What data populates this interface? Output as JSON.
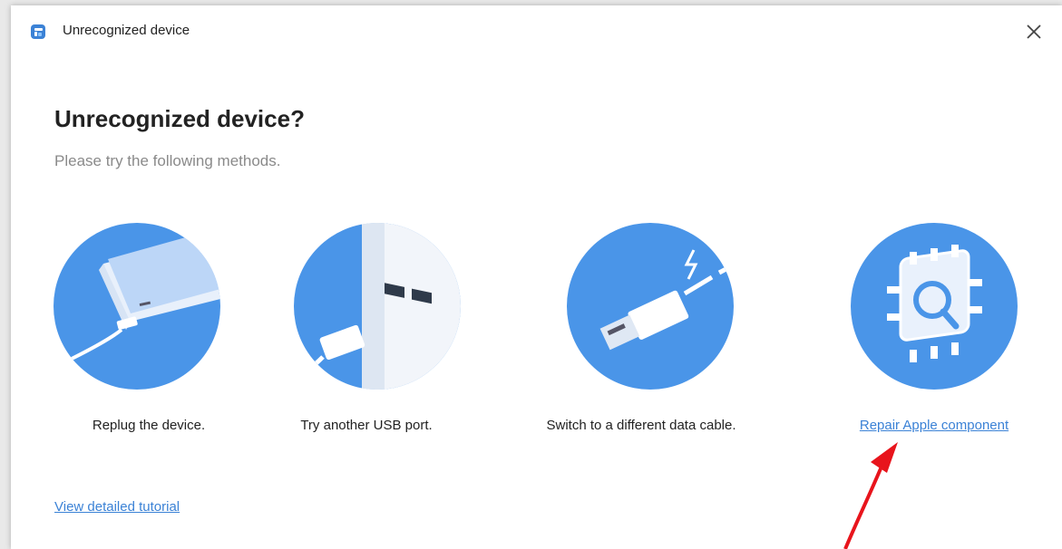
{
  "window": {
    "title": "Unrecognized device",
    "app_icon": "app-logo-icon",
    "close_icon": "close-icon"
  },
  "main": {
    "heading": "Unrecognized device?",
    "subheading": "Please try the following methods.",
    "methods": [
      {
        "label": "Replug the device.",
        "icon": "phone-replug-illustration"
      },
      {
        "label": "Try another USB port.",
        "icon": "usb-port-illustration"
      },
      {
        "label": "Switch to a different data cable.",
        "icon": "data-cable-illustration"
      },
      {
        "label": "Repair Apple component",
        "icon": "chip-repair-illustration"
      }
    ],
    "tutorial_link": "View detailed tutorial"
  },
  "colors": {
    "accent": "#3b82d6",
    "illustration_blue": "#4a95e8",
    "annotation_arrow": "#e8141c"
  }
}
